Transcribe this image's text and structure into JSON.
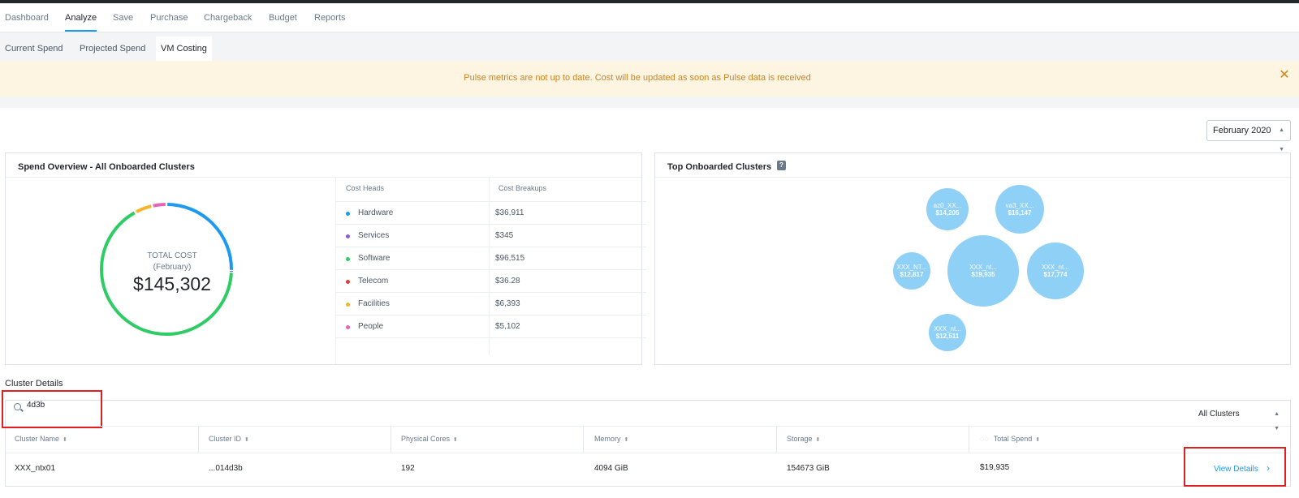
{
  "nav": {
    "tabs": [
      {
        "label": "Dashboard"
      },
      {
        "label": "Analyze",
        "active": true
      },
      {
        "label": "Save"
      },
      {
        "label": "Purchase"
      },
      {
        "label": "Chargeback"
      },
      {
        "label": "Budget"
      },
      {
        "label": "Reports"
      }
    ]
  },
  "subtabs": [
    {
      "label": "Current Spend"
    },
    {
      "label": "Projected Spend"
    },
    {
      "label": "VM Costing",
      "active": true
    }
  ],
  "banner": {
    "message": "Pulse metrics are not up to date. Cost will be updated as soon as Pulse data is received",
    "close_icon": "close-icon"
  },
  "period": {
    "selected": "February 2020"
  },
  "spend_overview": {
    "title": "Spend Overview - All Onboarded Clusters",
    "total_label": "TOTAL COST",
    "period_label": "(February)",
    "total_value": "$145,302",
    "table_headers": [
      "Cost Heads",
      "Cost Breakups"
    ],
    "rows": [
      {
        "name": "Hardware",
        "value": "$36,911",
        "color": "#1b9af0"
      },
      {
        "name": "Services",
        "value": "$345",
        "color": "#8b5cd6"
      },
      {
        "name": "Software",
        "value": "$96,515",
        "color": "#2fcc66"
      },
      {
        "name": "Telecom",
        "value": "$36.28",
        "color": "#e03c3c"
      },
      {
        "name": "Facilities",
        "value": "$6,393",
        "color": "#f6b42a"
      },
      {
        "name": "People",
        "value": "$5,102",
        "color": "#e763b5"
      }
    ]
  },
  "top_clusters": {
    "title": "Top Onboarded Clusters",
    "help_icon": "help-icon",
    "bubbles": [
      {
        "name": "az0_XX...",
        "value": "$14,205"
      },
      {
        "name": "va3_XX...",
        "value": "$16,147"
      },
      {
        "name": "XXX_NT...",
        "value": "$12,817"
      },
      {
        "name": "XXX_nt...",
        "value": "$19,935"
      },
      {
        "name": "XXX_nt...",
        "value": "$17,774"
      },
      {
        "name": "XXX_nt...",
        "value": "$12,511"
      }
    ]
  },
  "cluster_details": {
    "title": "Cluster Details",
    "search_value": "4d3b",
    "filter": "All Clusters",
    "columns": [
      "Cluster Name",
      "Cluster ID",
      "Physical Cores",
      "Memory",
      "Storage",
      "Total Spend"
    ],
    "rows": [
      {
        "cluster_name": "XXX_ntx01",
        "cluster_id": "...014d3b",
        "physical_cores": "192",
        "memory": "4094 GiB",
        "storage": "154673 GiB",
        "total_spend": "$19,935",
        "action": "View Details"
      }
    ]
  }
}
